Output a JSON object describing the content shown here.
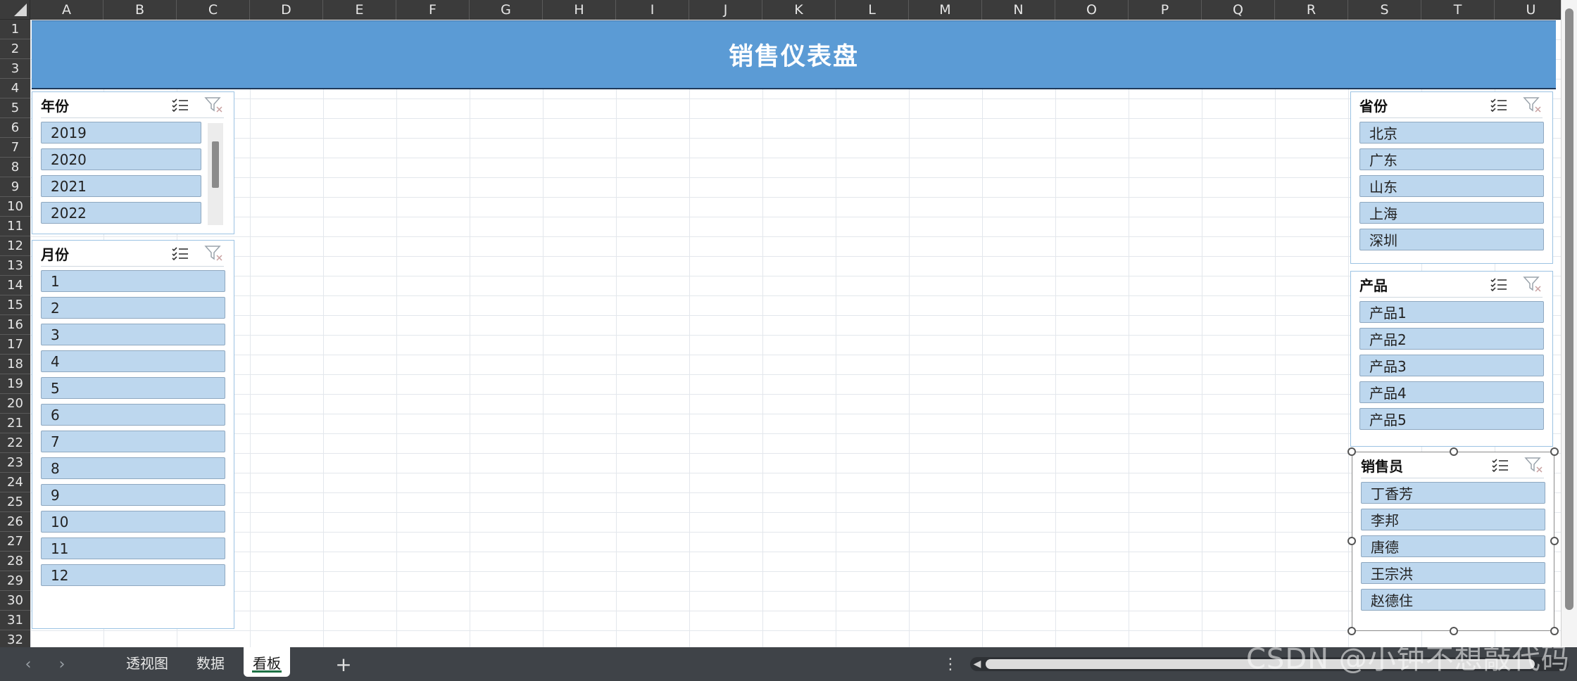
{
  "spreadsheet": {
    "columns": [
      "A",
      "B",
      "C",
      "D",
      "E",
      "F",
      "G",
      "H",
      "I",
      "J",
      "K",
      "L",
      "M",
      "N",
      "O",
      "P",
      "Q",
      "R",
      "S",
      "T",
      "U"
    ],
    "rows": [
      "1",
      "2",
      "3",
      "4",
      "5",
      "6",
      "7",
      "8",
      "9",
      "10",
      "11",
      "12",
      "13",
      "14",
      "15",
      "16",
      "17",
      "18",
      "19",
      "20",
      "21",
      "22",
      "23",
      "24",
      "25",
      "26",
      "27",
      "28",
      "29",
      "30",
      "31",
      "32"
    ]
  },
  "dashboard": {
    "title": "销售仪表盘",
    "banner_color": "#5b9bd5"
  },
  "slicers": {
    "year": {
      "title": "年份",
      "items": [
        "2019",
        "2020",
        "2021",
        "2022"
      ]
    },
    "month": {
      "title": "月份",
      "items": [
        "1",
        "2",
        "3",
        "4",
        "5",
        "6",
        "7",
        "8",
        "9",
        "10",
        "11",
        "12"
      ]
    },
    "province": {
      "title": "省份",
      "items": [
        "北京",
        "广东",
        "山东",
        "上海",
        "深圳"
      ]
    },
    "product": {
      "title": "产品",
      "items": [
        "产品1",
        "产品2",
        "产品3",
        "产品4",
        "产品5"
      ]
    },
    "salesperson": {
      "title": "销售员",
      "items": [
        "丁香芳",
        "李邦",
        "唐德",
        "王宗洪",
        "赵德住"
      ]
    },
    "icons": {
      "multiselect": "multi-select-icon",
      "clear_filter": "clear-filter-icon"
    },
    "item_color": "#bdd7ee"
  },
  "sheet_tabs": {
    "tabs": [
      "透视图",
      "数据",
      "看板"
    ],
    "active": "看板",
    "add_label": "+",
    "more_label": "⋮"
  },
  "watermark": "CSDN @小钟不想敲代码"
}
